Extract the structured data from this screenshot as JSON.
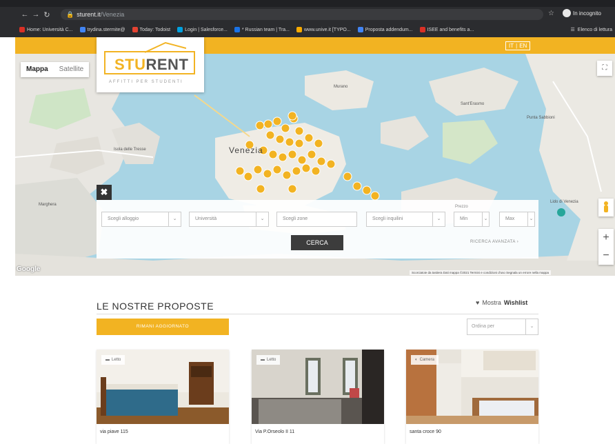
{
  "browser": {
    "url_host": "sturent.it",
    "url_path": "/Venezia",
    "incognito_label": "In incognito",
    "bookmarks": [
      {
        "label": "Home: Università C...",
        "color": "#d93025"
      },
      {
        "label": "trydina.stermite@",
        "color": "#4285f4"
      },
      {
        "label": "Today: Todoist",
        "color": "#e44332"
      },
      {
        "label": "Login | Salesforce...",
        "color": "#00a1e0"
      },
      {
        "label": "* Russian team | Tra...",
        "color": "#1a73e8"
      },
      {
        "label": "www.unive.it [TYPO...",
        "color": "#f9ab00"
      },
      {
        "label": "Proposta addendum...",
        "color": "#4285f4"
      },
      {
        "label": "ISEE and benefits a...",
        "color": "#d93025"
      }
    ],
    "bookmarks_other": "Elenco di lettura"
  },
  "header": {
    "lang_it": "IT",
    "lang_sep": "|",
    "lang_en": "EN",
    "logo_stu": "STU",
    "logo_rent": "RENT",
    "logo_tagline": "AFFITTI PER STUDENTI"
  },
  "map": {
    "type_map": "Mappa",
    "type_satellite": "Satellite",
    "google": "Google",
    "city_label": "Venezia",
    "labels": [
      "Murano",
      "Isola delle Tresse",
      "Sant'Erasmo",
      "Punta Sabbioni",
      "Marghera",
      "Lido",
      "Lido di Venezia"
    ],
    "footer": "Scorciatoie da tastiera   Dati mappa ©2021   Termini e condizioni d'uso   Segnala un errore nella mappa"
  },
  "search": {
    "alloggio": "Scegli alloggio",
    "universita": "Università",
    "zona": "Scegli zone",
    "inquilini": "Scegli inquilini",
    "prezzo_label": "Prezzo",
    "min": "Min",
    "max": "Max",
    "cerca": "CERCA",
    "avanzata": "RICERCA AVANZATA ›"
  },
  "proposals": {
    "title": "LE NOSTRE PROPOSTE",
    "wishlist_prefix": "Mostra",
    "wishlist_bold": "Wishlist",
    "updated_button": "RIMANI AGGIORNATO",
    "sort_placeholder": "Ordina per",
    "cards": [
      {
        "badge": "Letto",
        "address": "via piave 115"
      },
      {
        "badge": "Letto",
        "address": "Via P.Orseolo II 11"
      },
      {
        "badge": "Camera",
        "address": "santa croce 90"
      }
    ]
  }
}
